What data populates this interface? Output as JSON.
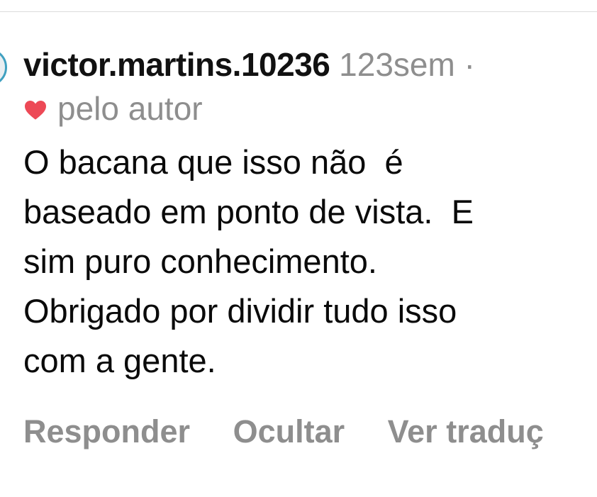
{
  "comment": {
    "username": "victor.martins.10236",
    "time": "123sem",
    "separator": "·",
    "liked_by_author": "pelo autor",
    "text": "O bacana que isso não  é\nbaseado em ponto de vista.  E\nsim puro conhecimento.\nObrigado por dividir tudo isso\ncom a gente.",
    "heart_icon": "heart-icon",
    "heart_color": "#ed4956"
  },
  "actions": {
    "reply": "Responder",
    "hide": "Ocultar",
    "translate": "Ver traduç"
  }
}
